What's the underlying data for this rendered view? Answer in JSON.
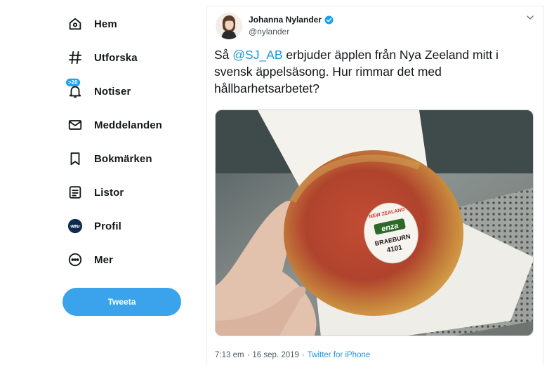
{
  "nav": {
    "items": [
      {
        "label": "Hem",
        "icon": "home-icon"
      },
      {
        "label": "Utforska",
        "icon": "hashtag-icon"
      },
      {
        "label": "Notiser",
        "icon": "bell-icon",
        "badge": ">20"
      },
      {
        "label": "Meddelanden",
        "icon": "envelope-icon"
      },
      {
        "label": "Bokmärken",
        "icon": "bookmark-icon"
      },
      {
        "label": "Listor",
        "icon": "list-icon"
      },
      {
        "label": "Profil",
        "icon": "profile-avatar-icon",
        "avatar_text": "ATL"
      },
      {
        "label": "Mer",
        "icon": "more-icon"
      }
    ],
    "tweet_button": "Tweeta"
  },
  "tweet": {
    "author": {
      "name": "Johanna Nylander",
      "handle": "@nylander",
      "verified": true
    },
    "text": {
      "before_mention": "Så ",
      "mention": "@SJ_AB",
      "after_mention": " erbjuder äpplen från Nya Zeeland mitt i svensk äppelsäsong. Hur rimmar det med hållbarhetsarbetet?"
    },
    "photo": {
      "sticker_top": "NEW ZEALAND",
      "sticker_brand": "enza",
      "sticker_variety": "BRAEBURN",
      "sticker_code": "4101"
    },
    "time": "7:13 em",
    "separator": "·",
    "date": "16 sep. 2019",
    "source": "Twitter for iPhone"
  },
  "colors": {
    "accent": "#1da1f2",
    "link": "#1b95e0",
    "tweet_button": "#3aa3ec",
    "text": "#14171a",
    "secondary": "#4d5a64"
  }
}
